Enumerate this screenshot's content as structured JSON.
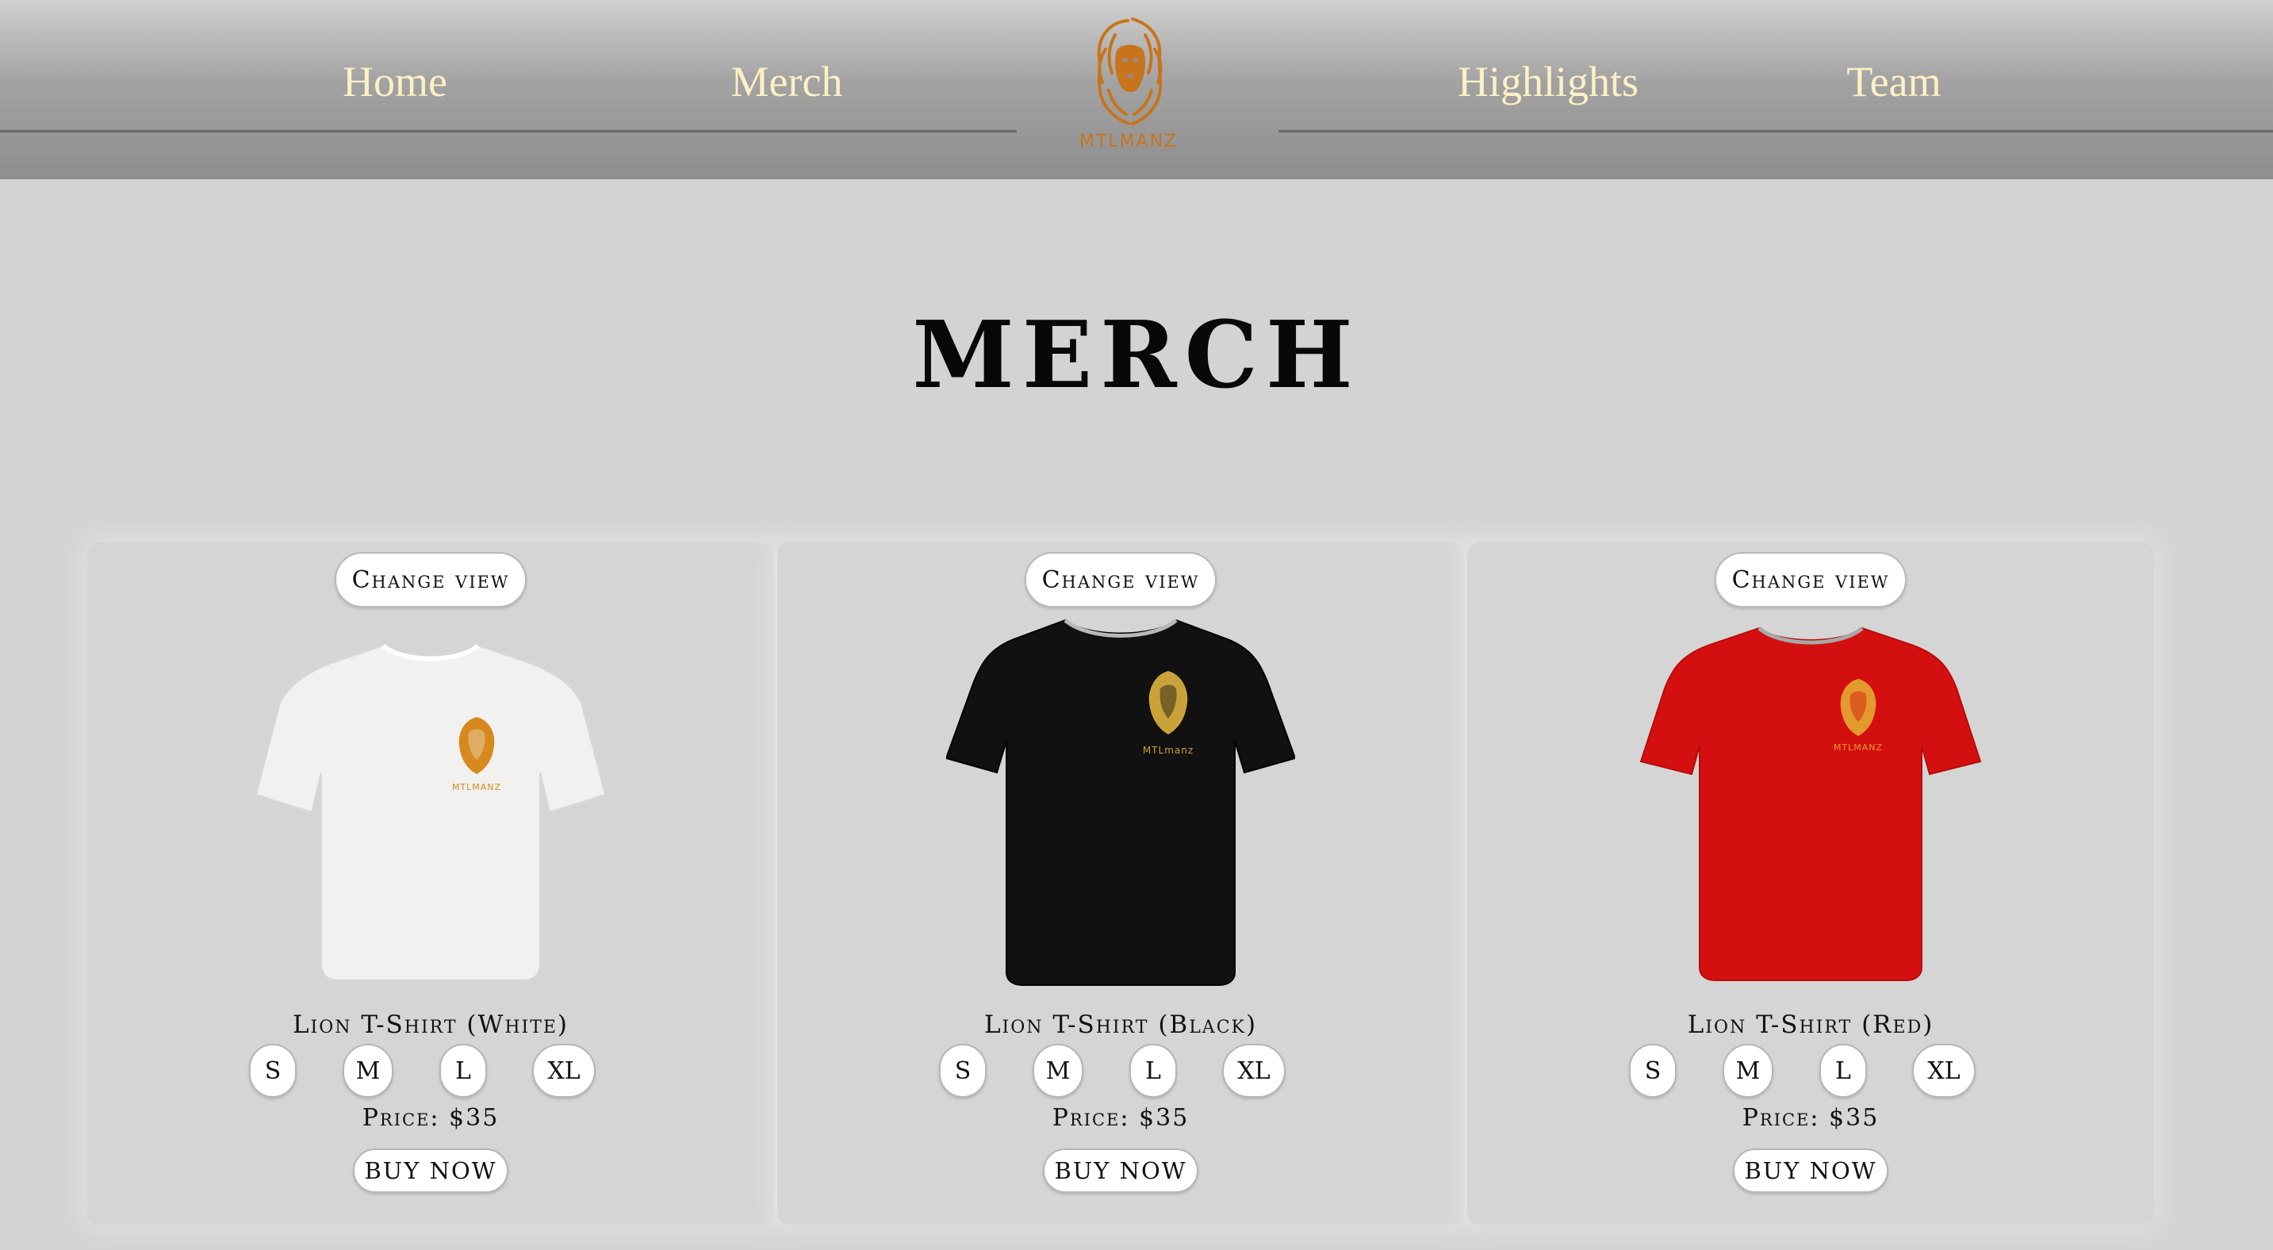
{
  "nav": {
    "items": [
      "Home",
      "Merch",
      "Highlights",
      "Team"
    ],
    "logo_text": "MTLMANZ",
    "text_color": "#fdf0c4",
    "logo_color": "#c8741c"
  },
  "page": {
    "title": "MERCH"
  },
  "products": [
    {
      "change_view_label": "Change view",
      "name": "Lion T-Shirt (White)",
      "shirt_color": "#f1f1ef",
      "print_text": "MTLMANZ",
      "sizes": [
        "S",
        "M",
        "L",
        "XL"
      ],
      "price": "Price: $35",
      "buy_label": "BUY NOW"
    },
    {
      "change_view_label": "Change view",
      "name": "Lion T-Shirt (Black)",
      "shirt_color": "#111111",
      "print_text": "MTLmanz",
      "sizes": [
        "S",
        "M",
        "L",
        "XL"
      ],
      "price": "Price: $35",
      "buy_label": "BUY NOW"
    },
    {
      "change_view_label": "Change view",
      "name": "Lion T-Shirt (Red)",
      "shirt_color": "#d40f0f",
      "print_text": "MTLMANZ",
      "sizes": [
        "S",
        "M",
        "L",
        "XL"
      ],
      "price": "Price: $35",
      "buy_label": "BUY NOW"
    }
  ]
}
